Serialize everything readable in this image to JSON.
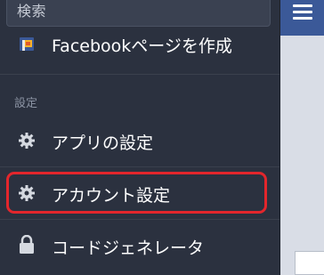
{
  "search": {
    "placeholder": "検索"
  },
  "menu": {
    "create_page": {
      "label": "Facebookページを作成",
      "icon": "facebook-page-flag-icon"
    },
    "section_settings": "設定",
    "app_settings": {
      "label": "アプリの設定",
      "icon": "gear-icon"
    },
    "account_settings": {
      "label": "アカウント設定",
      "icon": "gear-icon",
      "highlighted": true
    },
    "code_generator": {
      "label": "コードジェネレータ",
      "icon": "lock-icon"
    }
  },
  "colors": {
    "sidebar_bg": "#2b313f",
    "topbar_blue": "#3b5998",
    "highlight_red": "#e3262c",
    "text_white": "#ffffff",
    "section_gray": "#8b93a3"
  }
}
